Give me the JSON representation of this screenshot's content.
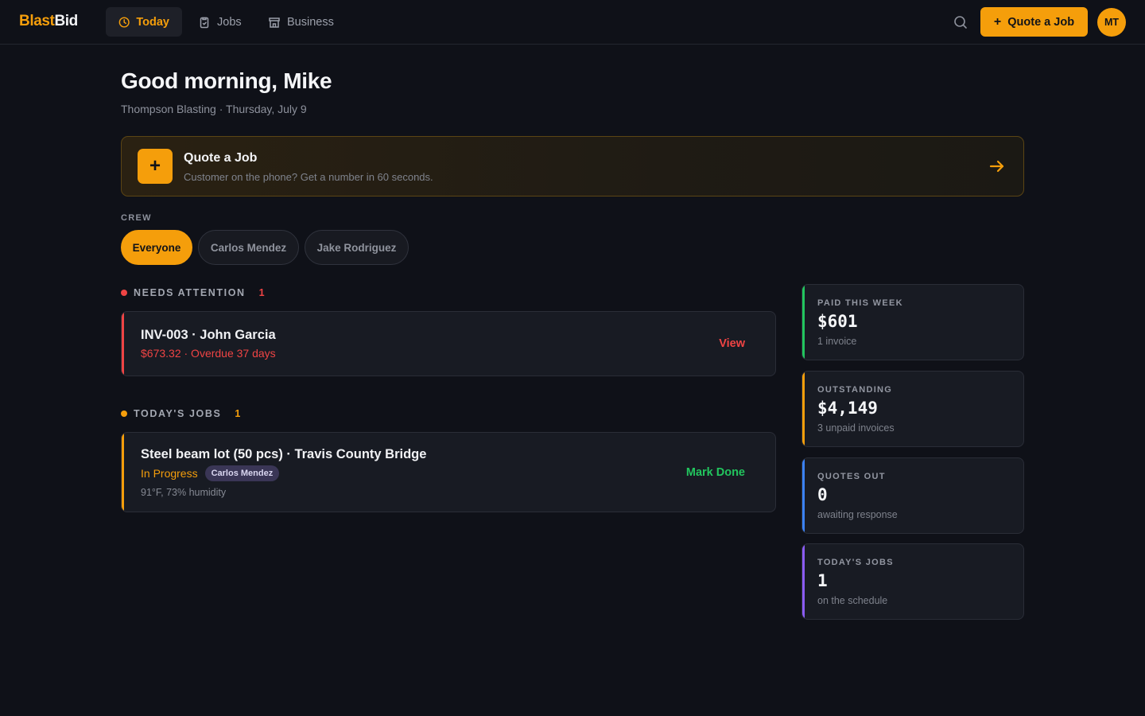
{
  "brand": {
    "part1": "Blast",
    "part2": "Bid"
  },
  "nav": {
    "tabs": [
      {
        "label": "Today",
        "icon": "clock-icon",
        "active": true
      },
      {
        "label": "Jobs",
        "icon": "clipboard-icon",
        "active": false
      },
      {
        "label": "Business",
        "icon": "storefront-icon",
        "active": false
      }
    ],
    "quote_button": "Quote a Job",
    "avatar_initials": "MT"
  },
  "header": {
    "greeting": "Good morning, Mike",
    "subline": "Thompson Blasting · Thursday, July 9"
  },
  "quote_banner": {
    "title": "Quote a Job",
    "subtitle": "Customer on the phone? Get a number in 60 seconds."
  },
  "crew": {
    "label": "CREW",
    "members": [
      {
        "name": "Everyone",
        "selected": true
      },
      {
        "name": "Carlos Mendez",
        "selected": false
      },
      {
        "name": "Jake Rodriguez",
        "selected": false
      }
    ]
  },
  "needs_attention": {
    "label": "NEEDS ATTENTION",
    "count": "1",
    "items": [
      {
        "title": "INV-003 · John Garcia",
        "detail": "$673.32 · Overdue 37 days",
        "action": "View"
      }
    ]
  },
  "todays_jobs": {
    "label": "TODAY'S JOBS",
    "count": "1",
    "items": [
      {
        "title": "Steel beam lot (50 pcs) · Travis County Bridge",
        "status": "In Progress",
        "crew": "Carlos Mendez",
        "weather": "91°F, 73% humidity",
        "action": "Mark Done"
      }
    ]
  },
  "stats": [
    {
      "label": "PAID THIS WEEK",
      "value": "$601",
      "sub": "1 invoice",
      "color": "#22c55e"
    },
    {
      "label": "OUTSTANDING",
      "value": "$4,149",
      "sub": "3 unpaid invoices",
      "color": "#f59e0b"
    },
    {
      "label": "QUOTES OUT",
      "value": "0",
      "sub": "awaiting response",
      "color": "#3b82f6"
    },
    {
      "label": "TODAY'S JOBS",
      "value": "1",
      "sub": "on the schedule",
      "color": "#8b5cf6"
    }
  ],
  "colors": {
    "accent": "#f59e0b",
    "danger": "#ef4444",
    "success": "#22c55e",
    "background": "#0f1118",
    "card": "#181b23"
  }
}
